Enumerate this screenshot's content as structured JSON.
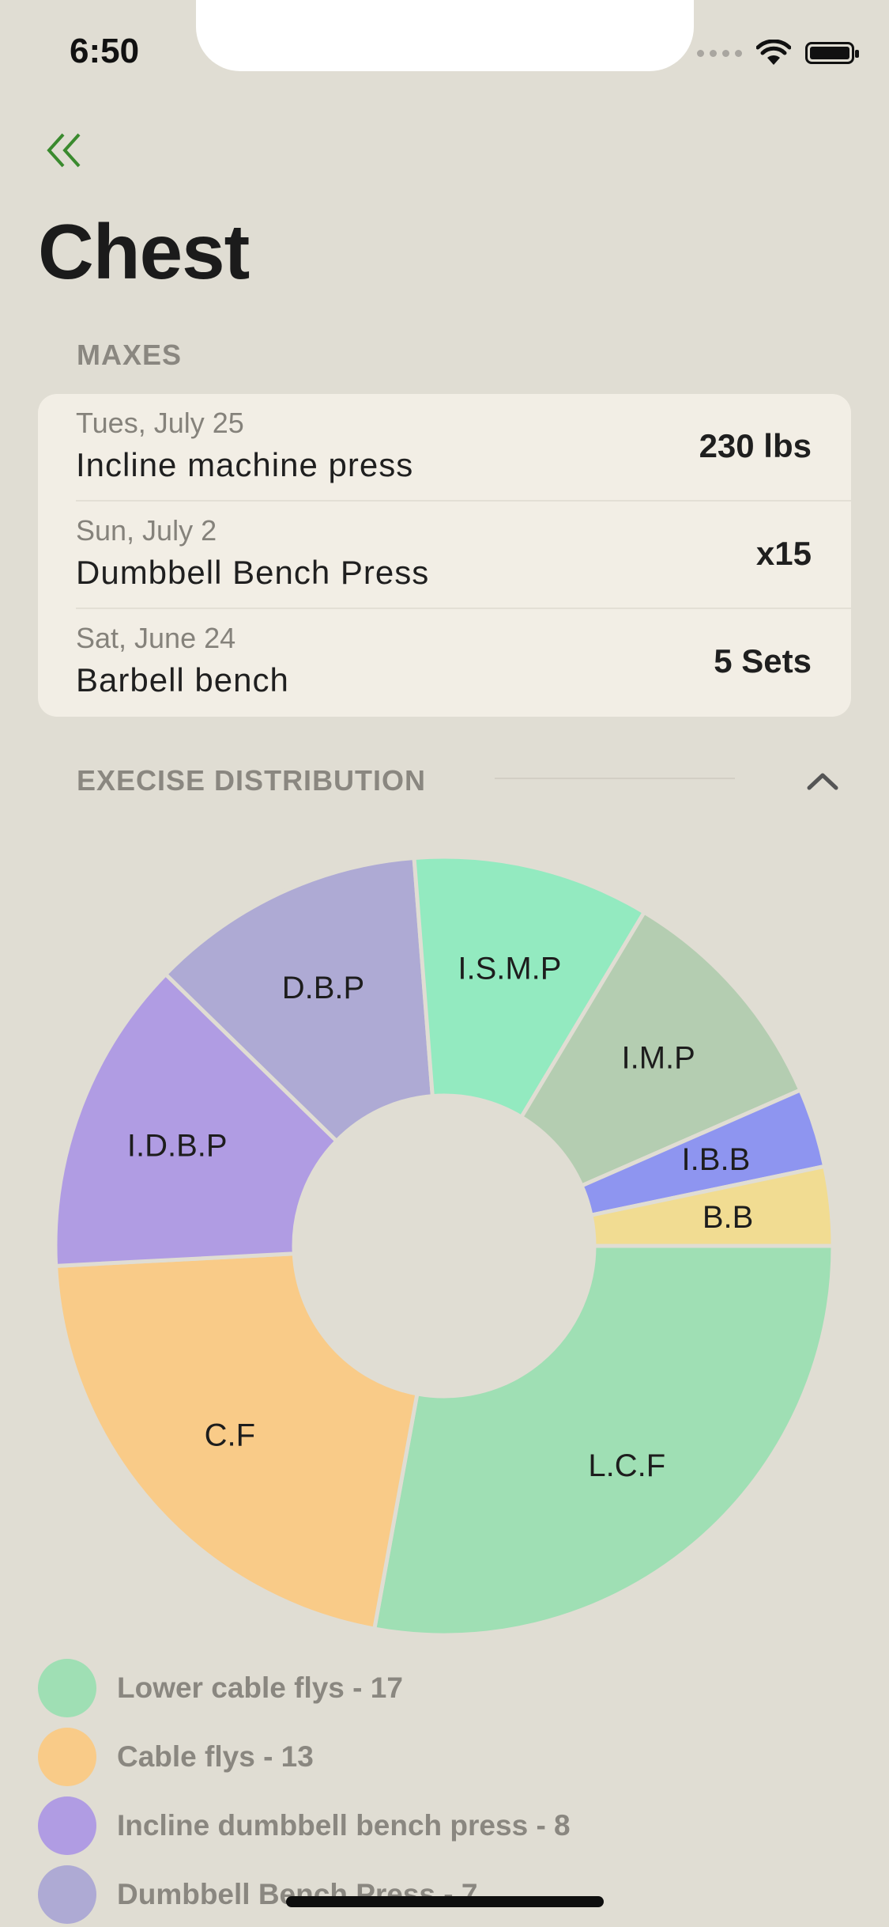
{
  "status_bar": {
    "time": "6:50"
  },
  "page": {
    "title": "Chest"
  },
  "maxes": {
    "header": "MAXES",
    "items": [
      {
        "date": "Tues, July 25",
        "name": "Incline machine press",
        "value": "230 lbs"
      },
      {
        "date": "Sun, July 2",
        "name": "Dumbbell Bench Press",
        "value": "x15"
      },
      {
        "date": "Sat, June 24",
        "name": "Barbell bench",
        "value": "5 Sets"
      }
    ]
  },
  "distribution": {
    "header": "EXECISE DISTRIBUTION",
    "collapse_icon": "chevron-up-icon"
  },
  "chart_data": {
    "type": "pie",
    "donut": true,
    "slices": [
      {
        "label": "L.C.F",
        "value": 17,
        "color": "#9fdfb4"
      },
      {
        "label": "C.F",
        "value": 13,
        "color": "#f9cb88"
      },
      {
        "label": "I.D.B.P",
        "value": 8,
        "color": "#b09ce3"
      },
      {
        "label": "D.B.P",
        "value": 7,
        "color": "#aeaad4"
      },
      {
        "label": "I.S.M.P",
        "value": 6,
        "color": "#93eac0"
      },
      {
        "label": "I.M.P",
        "value": 6,
        "color": "#b4cdb1"
      },
      {
        "label": "I.B.B",
        "value": 2,
        "color": "#8e95f0"
      },
      {
        "label": "B.B",
        "value": 2,
        "color": "#f1dc92"
      }
    ]
  },
  "legend": [
    {
      "text": "Lower cable flys - 17",
      "color": "#9fdfb4"
    },
    {
      "text": "Cable flys - 13",
      "color": "#f9cb88"
    },
    {
      "text": "Incline dumbbell bench press - 8",
      "color": "#b09ce3"
    },
    {
      "text": "Dumbbell Bench Press - 7",
      "color": "#aeaad4"
    }
  ]
}
